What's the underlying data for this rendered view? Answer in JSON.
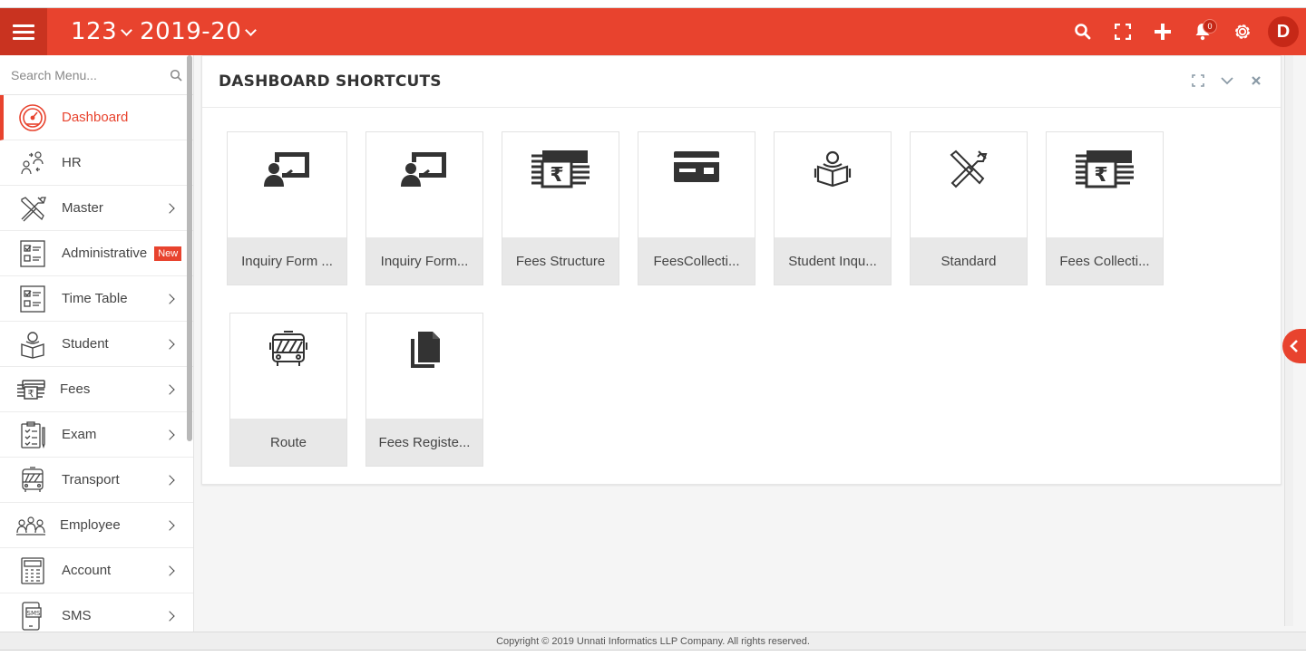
{
  "header": {
    "title_left": "123",
    "title_right": "2019-20",
    "notification_count": "0",
    "avatar_letter": "D",
    "bg_color": "#e8432e"
  },
  "sidebar": {
    "search_placeholder": "Search Menu...",
    "items": [
      {
        "label": "Dashboard",
        "icon": "dashboard-gauge-icon",
        "active": true
      },
      {
        "label": "HR",
        "icon": "hr-people-icon"
      },
      {
        "label": "Master",
        "icon": "tools-icon",
        "chevron": true
      },
      {
        "label": "Administrative",
        "icon": "checklist-icon",
        "badge": "New"
      },
      {
        "label": "Time Table",
        "icon": "checklist-icon",
        "chevron": true
      },
      {
        "label": "Student",
        "icon": "student-reading-icon",
        "chevron": true
      },
      {
        "label": "Fees",
        "icon": "money-stack-icon",
        "chevron": true
      },
      {
        "label": "Exam",
        "icon": "clipboard-icon",
        "chevron": true
      },
      {
        "label": "Transport",
        "icon": "bus-icon",
        "chevron": true
      },
      {
        "label": "Employee",
        "icon": "employees-icon",
        "chevron": true
      },
      {
        "label": "Account",
        "icon": "calculator-icon",
        "chevron": true
      },
      {
        "label": "SMS",
        "icon": "sms-phone-icon",
        "chevron": true
      }
    ]
  },
  "panel": {
    "title": "DASHBOARD SHORTCUTS",
    "tiles": [
      {
        "label": "Inquiry Form ...",
        "icon": "teacher-board-icon"
      },
      {
        "label": "Inquiry Form...",
        "icon": "teacher-board-icon"
      },
      {
        "label": "Fees Structure",
        "icon": "money-stack-icon"
      },
      {
        "label": "FeesCollecti...",
        "icon": "credit-card-icon"
      },
      {
        "label": "Student Inqu...",
        "icon": "student-reading-icon"
      },
      {
        "label": "Standard",
        "icon": "tools-icon"
      },
      {
        "label": "Fees Collecti...",
        "icon": "money-stack-icon"
      },
      {
        "label": "Route",
        "icon": "bus-icon"
      },
      {
        "label": "Fees Registe...",
        "icon": "copy-documents-icon"
      }
    ]
  },
  "footer": {
    "text": "Copyright © 2019 Unnati Informatics LLP Company. All rights reserved."
  }
}
